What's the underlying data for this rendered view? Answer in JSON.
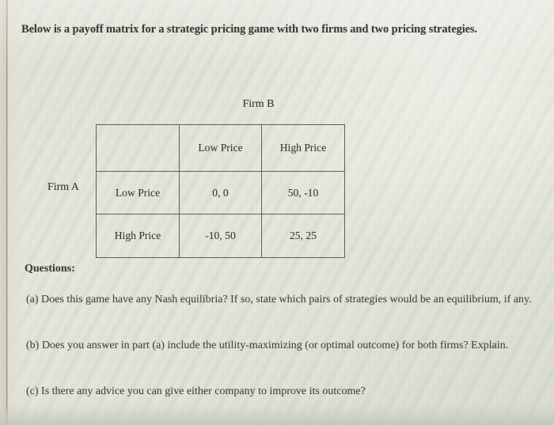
{
  "page": {
    "prompt": "Below is a payoff matrix for a strategic pricing game with two firms and two pricing strategies.",
    "background_color": "#e8e8dc",
    "text_color": "#3a3b38",
    "border_color": "#5d6058"
  },
  "matrix": {
    "column_player_label": "Firm B",
    "row_player_label": "Firm A",
    "corner_cell": "",
    "column_headers": [
      "Low Price",
      "High Price"
    ],
    "row_headers": [
      "Low Price",
      "High Price"
    ],
    "payoffs": [
      [
        "0, 0",
        "50, -10"
      ],
      [
        "-10, 50",
        "25, 25"
      ]
    ]
  },
  "questions": {
    "heading": "Questions:",
    "items": [
      "(a)  Does this game have any Nash equilibria?  If so, state which pairs of strategies would be an equilibrium, if any.",
      "(b)   Does you answer in part (a) include the utility-maximizing (or optimal outcome) for both firms?  Explain.",
      "(c)  Is there any advice you can give either company to improve its outcome?"
    ]
  },
  "chart_data": {
    "type": "table",
    "title": "Payoff matrix for a strategic pricing game",
    "row_player": "Firm A",
    "column_player": "Firm B",
    "categories": [
      "Low Price",
      "High Price"
    ],
    "cells": [
      {
        "row": "Low Price",
        "column": "Low Price",
        "firm_a": 0,
        "firm_b": 0,
        "label": "0, 0"
      },
      {
        "row": "Low Price",
        "column": "High Price",
        "firm_a": 50,
        "firm_b": -10,
        "label": "50, -10"
      },
      {
        "row": "High Price",
        "column": "Low Price",
        "firm_a": -10,
        "firm_b": 50,
        "label": "-10, 50"
      },
      {
        "row": "High Price",
        "column": "High Price",
        "firm_a": 25,
        "firm_b": 25,
        "label": "25, 25"
      }
    ]
  }
}
